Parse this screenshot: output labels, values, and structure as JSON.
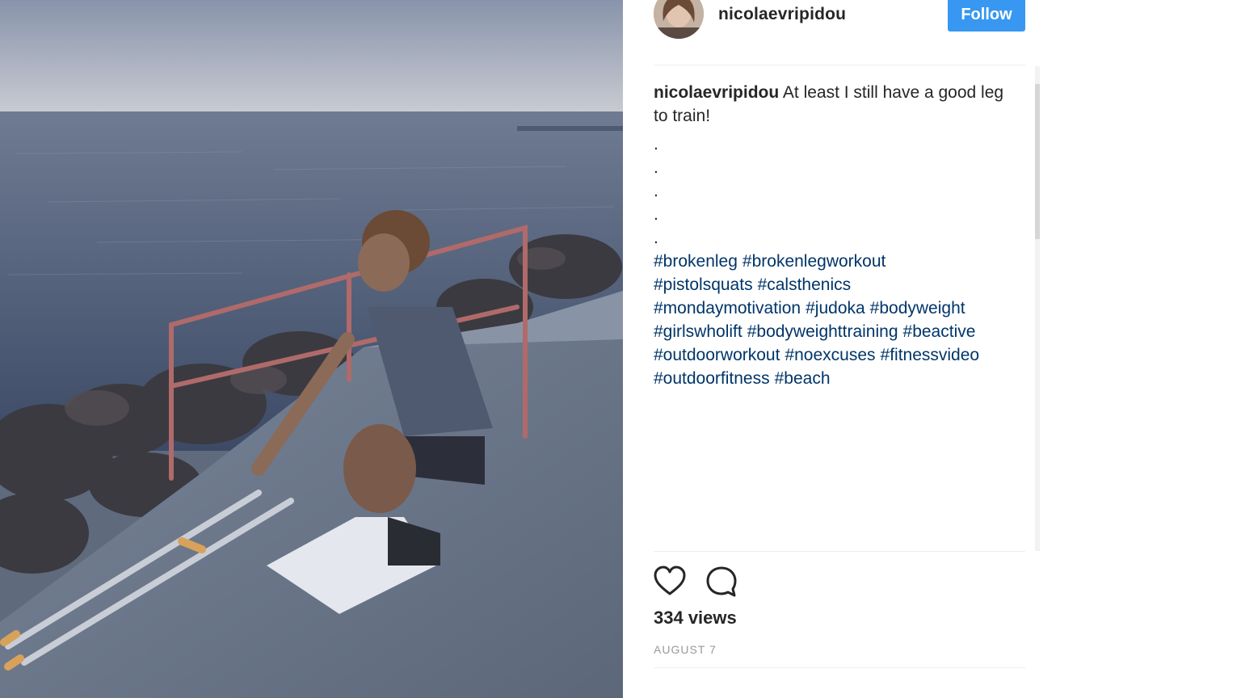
{
  "post": {
    "photo_alt": "",
    "username": "nicolaevripidou",
    "follow_label": "Follow",
    "caption_text": "At least I still have a good leg to train!",
    "caption_dots": [
      ".",
      ".",
      ".",
      ".",
      "."
    ],
    "hashtags": [
      "#brokenleg",
      "#brokenlegworkout",
      "#pistolsquats",
      "#calsthenics",
      "#mondaymotivation",
      "#judoka",
      "#bodyweight",
      "#girlswholift",
      "#bodyweighttraining",
      "#beactive",
      "#outdoorworkout",
      "#noexcuses",
      "#fitnessvideo",
      "#outdoorfitness",
      "#beach"
    ],
    "hashtag_lines": [
      [
        "#brokenleg",
        "#brokenlegworkout"
      ],
      [
        "#pistolsquats",
        "#calsthenics"
      ],
      [
        "#mondaymotivation",
        "#judoka",
        "#bodyweight"
      ],
      [
        "#girlswholift",
        "#bodyweighttraining",
        "#beactive"
      ],
      [
        "#outdoorworkout",
        "#noexcuses",
        "#fitnessvideo"
      ],
      [
        "#outdoorfitness",
        "#beach"
      ]
    ],
    "views": "334 views",
    "date": "AUGUST 7"
  },
  "icons": {
    "like": "heart-icon",
    "comment": "comment-icon"
  },
  "colors": {
    "follow_button": "#3897f0",
    "hashtag": "#003569",
    "text": "#262626",
    "muted": "#999999"
  }
}
